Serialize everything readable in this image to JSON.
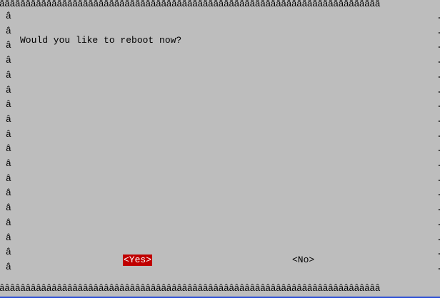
{
  "terminal": {
    "border_glyphs": "âââââââââââââââââââââââââââââââââââââââââââââââââââââââââââââââââââââââââ",
    "side_glyph": "â",
    "right_glyph": "."
  },
  "dialog": {
    "message": "Would you like to reboot now?",
    "yes_label": "<Yes>",
    "no_label": "<No>"
  },
  "colors": {
    "background": "#bdbdbd",
    "selected_button": "#c00000",
    "bottom_edge": "#2c4fd6"
  }
}
